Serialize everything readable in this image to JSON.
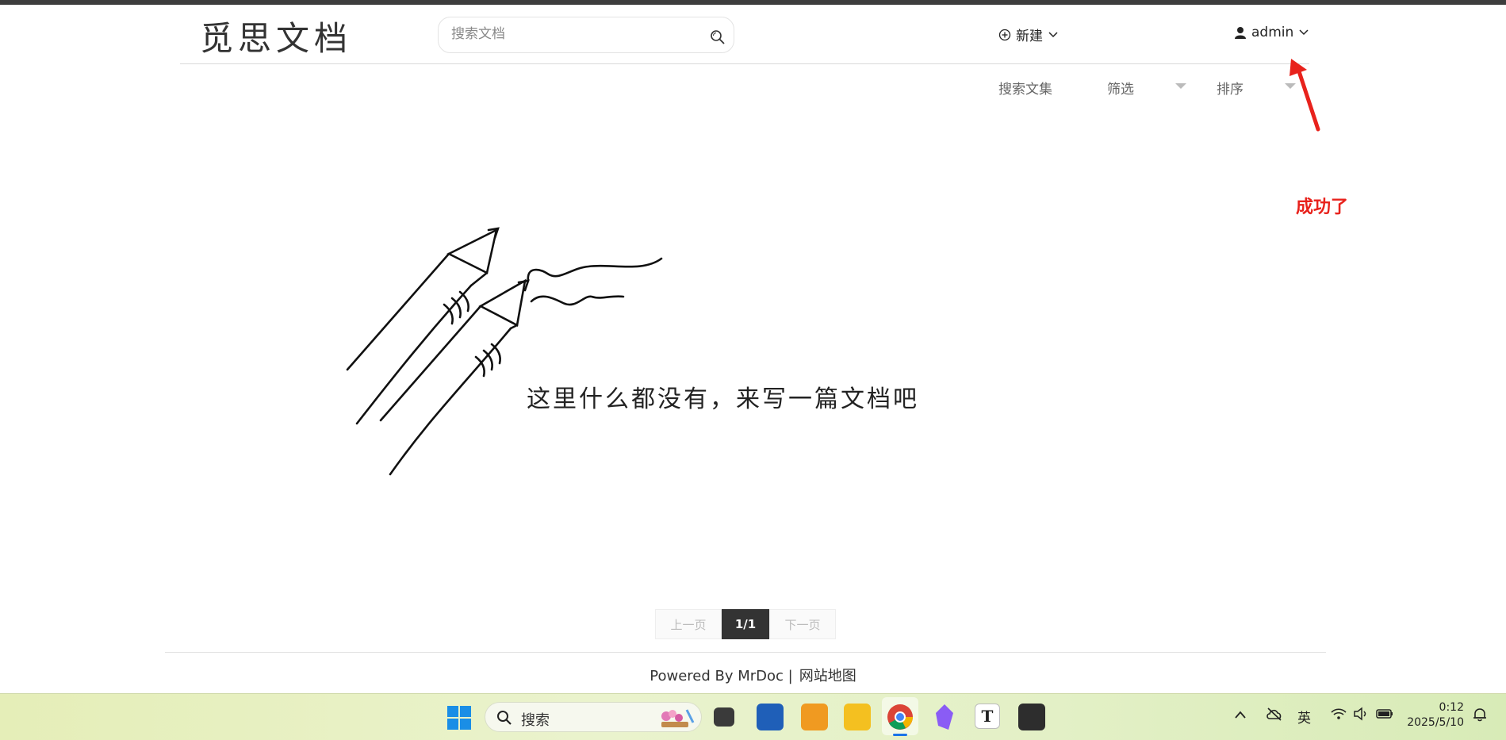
{
  "header": {
    "logo": "觅思文档",
    "search_placeholder": "搜索文档",
    "new_label": "新建",
    "user_label": "admin"
  },
  "toolbar": {
    "search_collection": "搜索文集",
    "filter": "筛选",
    "sort": "排序"
  },
  "annotation": "成功了",
  "empty_state": {
    "message": "这里什么都没有，来写一篇文档吧"
  },
  "pagination": {
    "prev": "上一页",
    "current": "1/1",
    "next": "下一页"
  },
  "footer": {
    "powered_by": "Powered By MrDoc |",
    "sitemap": "网站地图"
  },
  "taskbar": {
    "search_label": "搜索",
    "ime": "英",
    "time": "0:12",
    "date": "2025/5/10"
  },
  "colors": {
    "annotation_red": "#e8221c",
    "active_page": "#333333",
    "top_bar": "#3d3d3d"
  }
}
